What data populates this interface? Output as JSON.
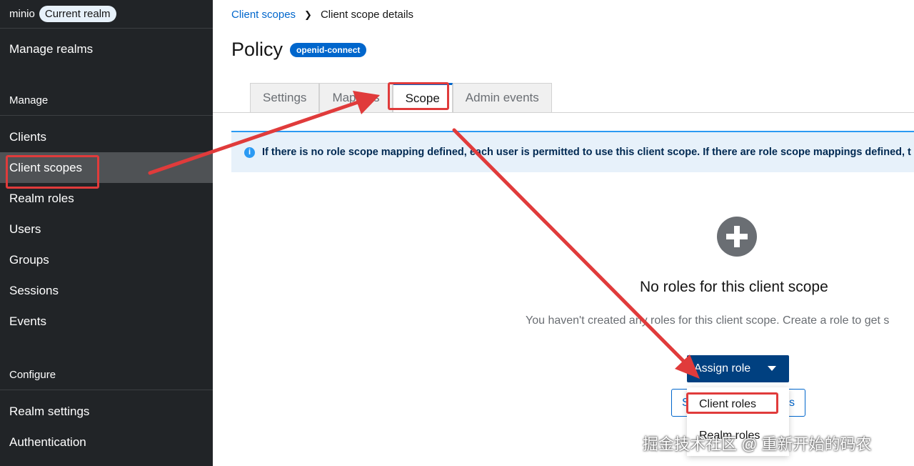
{
  "sidebar": {
    "realm_name": "minio",
    "realm_badge": "Current realm",
    "manage_realms": "Manage realms",
    "section_manage": "Manage",
    "items_manage": [
      "Clients",
      "Client scopes",
      "Realm roles",
      "Users",
      "Groups",
      "Sessions",
      "Events"
    ],
    "section_configure": "Configure",
    "items_configure": [
      "Realm settings",
      "Authentication"
    ]
  },
  "breadcrumb": {
    "parent": "Client scopes",
    "current": "Client scope details"
  },
  "page": {
    "title": "Policy",
    "protocol_badge": "openid-connect"
  },
  "tabs": [
    "Settings",
    "Mappers",
    "Scope",
    "Admin events"
  ],
  "alert": {
    "text": "If there is no role scope mapping defined, each user is permitted to use this client scope. If there are role scope mappings defined, t"
  },
  "empty_state": {
    "title": "No roles for this client scope",
    "body": "You haven't created any roles for this client scope. Create a role to get s"
  },
  "assign_button": "Assign role",
  "secondary_button": {
    "left": "S",
    "right": "s"
  },
  "dropdown": [
    "Client roles",
    "Realm roles"
  ],
  "watermark": "掘金技术社区 @ 重新开始的码农",
  "colors": {
    "sidebar_bg": "#212427",
    "accent": "#0066cc",
    "annotation_red": "#e03b3b",
    "primary_btn": "#004080"
  }
}
